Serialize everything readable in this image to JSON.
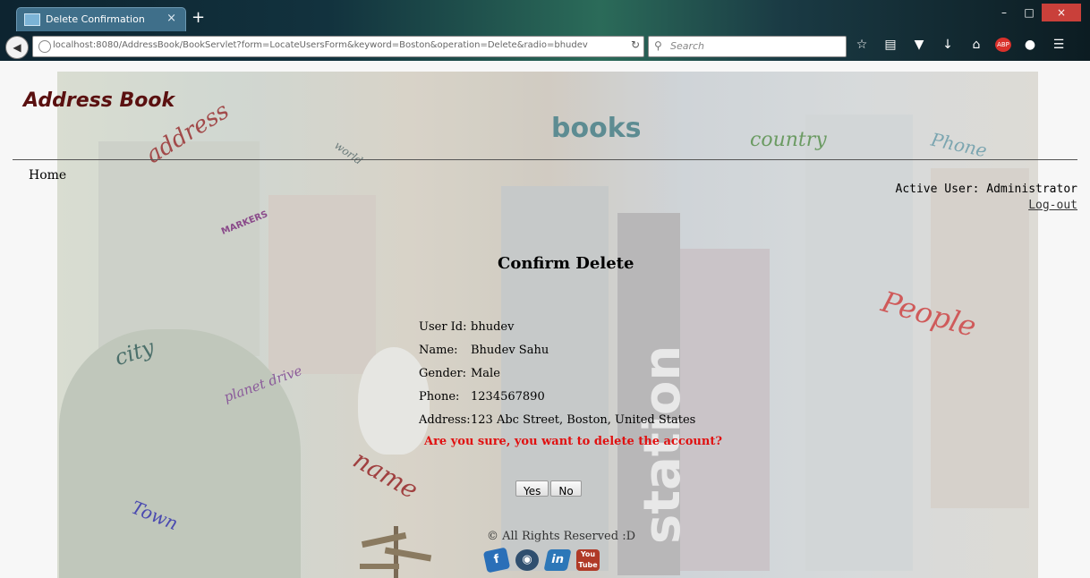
{
  "browser": {
    "tab_title": "Delete Confirmation",
    "tab_close": "×",
    "new_tab": "+",
    "url": "localhost:8080/AddressBook/BookServlet?form=LocateUsersForm&keyword=Boston&operation=Delete&radio=bhudev",
    "search_placeholder": "Search",
    "window_buttons": [
      "–",
      "□",
      "×"
    ]
  },
  "header": {
    "brand": "Address Book",
    "nav_home": "Home",
    "active_user": "Active User: Administrator",
    "logout": "Log-out"
  },
  "background_words": {
    "address": "address",
    "world": "world",
    "books": "books",
    "country": "country",
    "phone": "Phone",
    "markers": "MARKERS",
    "people": "People",
    "city": "city",
    "planet_drive": "planet drive",
    "name": "name",
    "town": "Town",
    "station": "station"
  },
  "confirm": {
    "title": "Confirm Delete",
    "fields": [
      {
        "label": "User Id:",
        "value": "bhudev"
      },
      {
        "label": "Name:",
        "value": "Bhudev Sahu"
      },
      {
        "label": "Gender:",
        "value": "Male"
      },
      {
        "label": "Phone:",
        "value": "1234567890"
      },
      {
        "label": "Address:",
        "value": "123 Abc Street, Boston, United States"
      }
    ],
    "warning": "Are you sure, you want to delete the account?",
    "yes": "Yes",
    "no": "No"
  },
  "footer": {
    "copyright": "© All Rights Reserved :D",
    "youtube_text": "You Tube"
  },
  "colors": {
    "brand": "#5a1010",
    "warning": "#e01010"
  }
}
